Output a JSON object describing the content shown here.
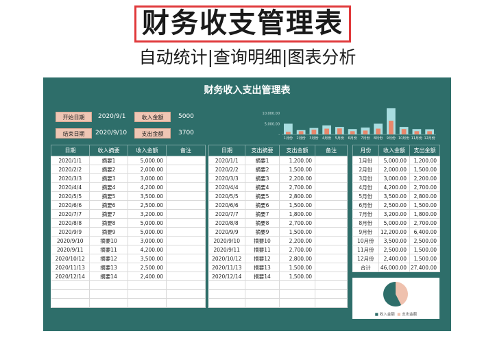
{
  "promo": {
    "title": "财务收支管理表",
    "subtitle": "自动统计|查询明细|图表分析"
  },
  "sheet": {
    "title": "财务收入支出管理表",
    "start_label": "开始日期",
    "start_value": "2020/9/1",
    "end_label": "结束日期",
    "end_value": "2020/9/10",
    "income_label": "收入金额",
    "income_value": "5000",
    "expense_label": "支出金额",
    "expense_value": "3700"
  },
  "income_table": {
    "headers": [
      "日期",
      "收入摘要",
      "收入金额",
      "备注"
    ],
    "rows": [
      [
        "2020/1/1",
        "摘要1",
        "5,000.00",
        ""
      ],
      [
        "2020/2/2",
        "摘要2",
        "2,000.00",
        ""
      ],
      [
        "2020/3/3",
        "摘要3",
        "3,000.00",
        ""
      ],
      [
        "2020/4/4",
        "摘要4",
        "4,200.00",
        ""
      ],
      [
        "2020/5/5",
        "摘要5",
        "3,500.00",
        ""
      ],
      [
        "2020/6/6",
        "摘要6",
        "2,500.00",
        ""
      ],
      [
        "2020/7/7",
        "摘要7",
        "3,200.00",
        ""
      ],
      [
        "2020/8/8",
        "摘要8",
        "5,000.00",
        ""
      ],
      [
        "2020/9/9",
        "摘要9",
        "5,000.00",
        ""
      ],
      [
        "2020/9/10",
        "摘要10",
        "3,000.00",
        ""
      ],
      [
        "2020/9/11",
        "摘要11",
        "4,200.00",
        ""
      ],
      [
        "2020/10/12",
        "摘要12",
        "3,500.00",
        ""
      ],
      [
        "2020/11/13",
        "摘要13",
        "2,500.00",
        ""
      ],
      [
        "2020/12/14",
        "摘要14",
        "2,400.00",
        ""
      ]
    ]
  },
  "expense_table": {
    "headers": [
      "日期",
      "支出摘要",
      "支出金额",
      "备注"
    ],
    "rows": [
      [
        "2020/1/1",
        "摘要1",
        "1,200.00",
        ""
      ],
      [
        "2020/2/2",
        "摘要2",
        "1,500.00",
        ""
      ],
      [
        "2020/3/3",
        "摘要3",
        "2,200.00",
        ""
      ],
      [
        "2020/4/4",
        "摘要4",
        "2,700.00",
        ""
      ],
      [
        "2020/5/5",
        "摘要5",
        "2,800.00",
        ""
      ],
      [
        "2020/6/6",
        "摘要6",
        "1,500.00",
        ""
      ],
      [
        "2020/7/7",
        "摘要7",
        "1,800.00",
        ""
      ],
      [
        "2020/8/8",
        "摘要8",
        "2,700.00",
        ""
      ],
      [
        "2020/9/9",
        "摘要9",
        "1,500.00",
        ""
      ],
      [
        "2020/9/10",
        "摘要10",
        "2,200.00",
        ""
      ],
      [
        "2020/9/11",
        "摘要11",
        "2,700.00",
        ""
      ],
      [
        "2020/10/12",
        "摘要12",
        "2,800.00",
        ""
      ],
      [
        "2020/11/13",
        "摘要13",
        "1,500.00",
        ""
      ],
      [
        "2020/12/14",
        "摘要14",
        "1,500.00",
        ""
      ]
    ]
  },
  "monthly_table": {
    "headers": [
      "月份",
      "收入金额",
      "支出金额"
    ],
    "rows": [
      [
        "1月份",
        "5,000.00",
        "1,200.00"
      ],
      [
        "2月份",
        "2,000.00",
        "1,500.00"
      ],
      [
        "3月份",
        "3,000.00",
        "2,200.00"
      ],
      [
        "4月份",
        "4,200.00",
        "2,700.00"
      ],
      [
        "5月份",
        "3,500.00",
        "2,800.00"
      ],
      [
        "6月份",
        "2,500.00",
        "1,500.00"
      ],
      [
        "7月份",
        "3,200.00",
        "1,800.00"
      ],
      [
        "8月份",
        "5,000.00",
        "2,700.00"
      ],
      [
        "9月份",
        "12,200.00",
        "6,400.00"
      ],
      [
        "10月份",
        "3,500.00",
        "2,500.00"
      ],
      [
        "11月份",
        "2,500.00",
        "1,500.00"
      ],
      [
        "12月份",
        "2,400.00",
        "1,500.00"
      ],
      [
        "合计",
        "46,000.00",
        "27,400.00"
      ]
    ]
  },
  "chart_data": [
    {
      "type": "bar",
      "categories": [
        "1月份",
        "2月份",
        "3月份",
        "4月份",
        "5月份",
        "6月份",
        "7月份",
        "8月份",
        "9月份",
        "10月份",
        "11月份",
        "12月份"
      ],
      "series": [
        {
          "name": "收入金额",
          "values": [
            5000,
            2000,
            3000,
            4200,
            3500,
            2500,
            3200,
            5000,
            12200,
            3500,
            2500,
            2400
          ]
        },
        {
          "name": "支出金额",
          "values": [
            1200,
            1500,
            2200,
            2700,
            2800,
            1500,
            1800,
            2700,
            6400,
            2500,
            1500,
            1500
          ]
        }
      ],
      "yticks": [
        "10,000.00",
        "5,000.00",
        "-"
      ],
      "ylim": [
        0,
        12500
      ],
      "colors": {
        "income": "#a8dde0",
        "expense": "#e9876b"
      }
    },
    {
      "type": "pie",
      "categories": [
        "收入金额",
        "支出金额"
      ],
      "values": [
        3700,
        5000
      ],
      "colors": {
        "income": "#efc1ae",
        "expense": "#2e6e6a"
      }
    }
  ]
}
